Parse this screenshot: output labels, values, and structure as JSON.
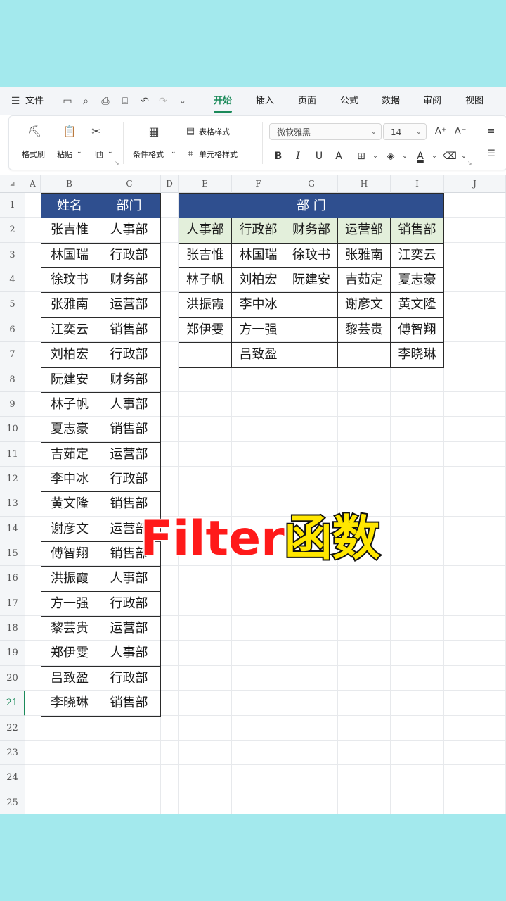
{
  "menu": {
    "file": "文件",
    "tabs": [
      "开始",
      "插入",
      "页面",
      "公式",
      "数据",
      "审阅",
      "视图"
    ],
    "active_tab": "开始"
  },
  "ribbon": {
    "format_painter": "格式刷",
    "paste": "粘贴",
    "conditional_format": "条件格式",
    "table_style": "表格样式",
    "cell_style": "单元格样式",
    "font_name": "微软雅黑",
    "font_size": "14"
  },
  "sheet": {
    "columns": [
      "A",
      "B",
      "C",
      "D",
      "E",
      "F",
      "G",
      "H",
      "I",
      "J"
    ],
    "rows": [
      "1",
      "2",
      "3",
      "4",
      "5",
      "6",
      "7",
      "8",
      "9",
      "10",
      "11",
      "12",
      "13",
      "14",
      "15",
      "16",
      "17",
      "18",
      "19",
      "20",
      "21",
      "22",
      "23",
      "24",
      "25"
    ],
    "selected_row": "21",
    "source_headers": [
      "姓名",
      "部门"
    ],
    "source_rows": [
      [
        "张吉惟",
        "人事部"
      ],
      [
        "林国瑞",
        "行政部"
      ],
      [
        "徐玟书",
        "财务部"
      ],
      [
        "张雅南",
        "运营部"
      ],
      [
        "江奕云",
        "销售部"
      ],
      [
        "刘柏宏",
        "行政部"
      ],
      [
        "阮建安",
        "财务部"
      ],
      [
        "林子帆",
        "人事部"
      ],
      [
        "夏志豪",
        "销售部"
      ],
      [
        "吉茹定",
        "运营部"
      ],
      [
        "李中冰",
        "行政部"
      ],
      [
        "黄文隆",
        "销售部"
      ],
      [
        "谢彦文",
        "运营部"
      ],
      [
        "傅智翔",
        "销售部"
      ],
      [
        "洪振霞",
        "人事部"
      ],
      [
        "方一强",
        "行政部"
      ],
      [
        "黎芸贵",
        "运营部"
      ],
      [
        "郑伊雯",
        "人事部"
      ],
      [
        "吕致盈",
        "行政部"
      ],
      [
        "李晓琳",
        "销售部"
      ]
    ],
    "result_title": "部 门",
    "result_headers": [
      "人事部",
      "行政部",
      "财务部",
      "运营部",
      "销售部"
    ],
    "result_rows": [
      [
        "张吉惟",
        "林国瑞",
        "徐玟书",
        "张雅南",
        "江奕云"
      ],
      [
        "林子帆",
        "刘柏宏",
        "阮建安",
        "吉茹定",
        "夏志豪"
      ],
      [
        "洪振霞",
        "李中冰",
        "",
        "谢彦文",
        "黄文隆"
      ],
      [
        "郑伊雯",
        "方一强",
        "",
        "黎芸贵",
        "傅智翔"
      ],
      [
        "",
        "吕致盈",
        "",
        "",
        "李晓琳"
      ]
    ]
  },
  "overlay": {
    "part1": "Filter",
    "part2": "函数"
  }
}
